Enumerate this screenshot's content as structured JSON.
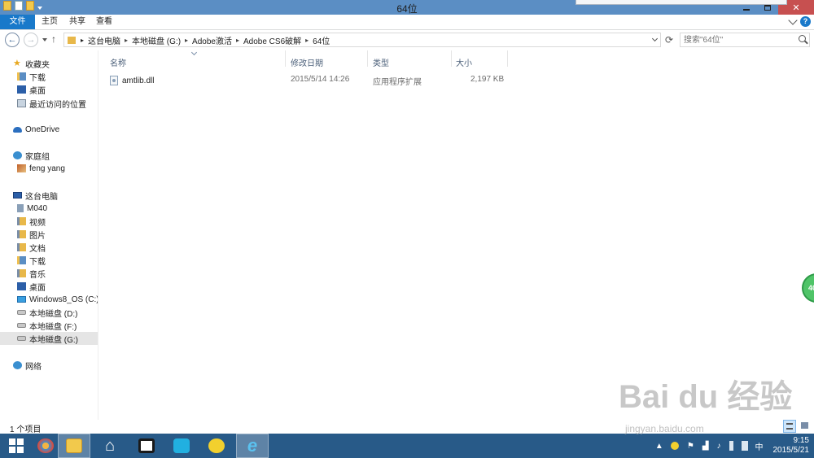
{
  "window": {
    "title": "64位"
  },
  "ribbon": {
    "tabs": {
      "file": "文件",
      "home": "主页",
      "share": "共享",
      "view": "查看"
    }
  },
  "address": {
    "crumbs": [
      "这台电脑",
      "本地磁盘 (G:)",
      "Adobe激活",
      "Adobe CS6破解",
      "64位"
    ]
  },
  "search": {
    "placeholder": "搜索\"64位\""
  },
  "nav": {
    "favorites": "收藏夹",
    "fav_items": [
      "下载",
      "桌面",
      "最近访问的位置"
    ],
    "onedrive": "OneDrive",
    "homegroup": "家庭组",
    "homegroup_user": "feng yang",
    "thispc": "这台电脑",
    "pc_items": [
      "M040",
      "视频",
      "图片",
      "文档",
      "下载",
      "音乐",
      "桌面",
      "Windows8_OS (C:)",
      "本地磁盘 (D:)",
      "本地磁盘 (F:)",
      "本地磁盘 (G:)"
    ],
    "network": "网络"
  },
  "columns": {
    "name": "名称",
    "modified": "修改日期",
    "type": "类型",
    "size": "大小"
  },
  "files": [
    {
      "name": "amtlib.dll",
      "modified": "2015/5/14 14:26",
      "type": "应用程序扩展",
      "size": "2,197 KB"
    }
  ],
  "status": {
    "count": "1 个项目"
  },
  "taskbar": {
    "tray_lang": "中",
    "time": "9:15",
    "date": "2015/5/21"
  },
  "watermark": {
    "main": "Bai du 经验",
    "sub": "jingyan.baidu.com"
  },
  "float_badge": "40",
  "colors": {
    "titlebar": "#5b8ec4",
    "file_tab": "#1979ca",
    "taskbar": "#285a88",
    "close": "#c75050"
  }
}
